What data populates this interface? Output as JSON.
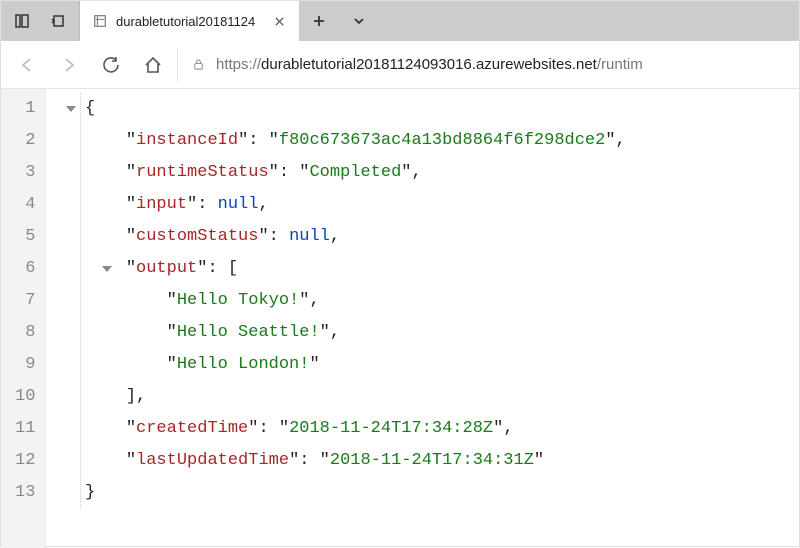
{
  "titlebar": {
    "tab_title": "durabletutorial20181124"
  },
  "addressbar": {
    "scheme": "https://",
    "host": "durabletutorial20181124093016.azurewebsites.net",
    "path": "/runtim"
  },
  "json": {
    "instanceId": "f80c673673ac4a13bd8864f6f298dce2",
    "runtimeStatus": "Completed",
    "input": "null",
    "customStatus": "null",
    "output": [
      "Hello Tokyo!",
      "Hello Seattle!",
      "Hello London!"
    ],
    "createdTime": "2018-11-24T17:34:28Z",
    "lastUpdatedTime": "2018-11-24T17:34:31Z"
  },
  "labels": {
    "instanceId": "instanceId",
    "runtimeStatus": "runtimeStatus",
    "input": "input",
    "customStatus": "customStatus",
    "output": "output",
    "createdTime": "createdTime",
    "lastUpdatedTime": "lastUpdatedTime"
  },
  "gutter": [
    "1",
    "2",
    "3",
    "4",
    "5",
    "6",
    "7",
    "8",
    "9",
    "10",
    "11",
    "12",
    "13"
  ]
}
